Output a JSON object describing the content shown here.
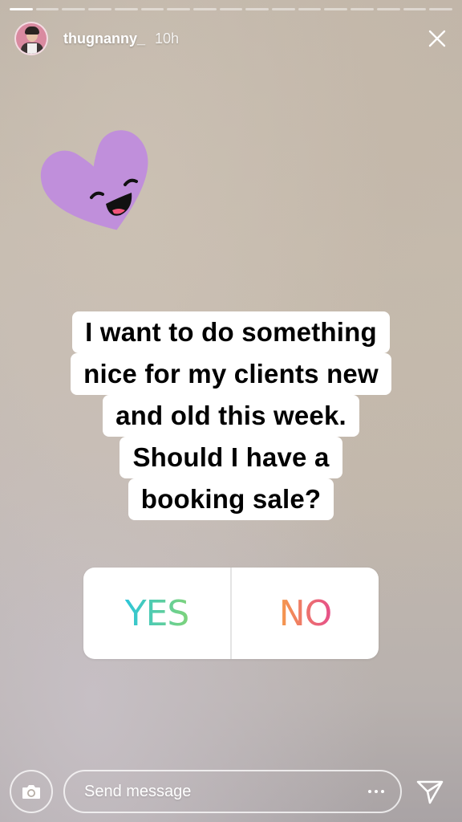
{
  "progress": {
    "segments": 17,
    "active_index": 0
  },
  "header": {
    "username": "thugnanny_",
    "time": "10h"
  },
  "sticker": {
    "icon": "smiling-heart-icon",
    "color": "#c08fdb"
  },
  "question": {
    "lines": [
      "I want to do something",
      "nice for my clients new",
      "and old this week.",
      "Should I have a",
      "booking sale?"
    ]
  },
  "poll": {
    "options": [
      {
        "label": "YES",
        "gradient": [
          "#2dc6d9",
          "#7ed37a"
        ]
      },
      {
        "label": "NO",
        "gradient": [
          "#f59b4b",
          "#e64f8a"
        ]
      }
    ]
  },
  "footer": {
    "message_placeholder": "Send message",
    "camera_icon": "camera-icon",
    "more_icon": "more-dots-icon",
    "send_icon": "send-icon"
  }
}
